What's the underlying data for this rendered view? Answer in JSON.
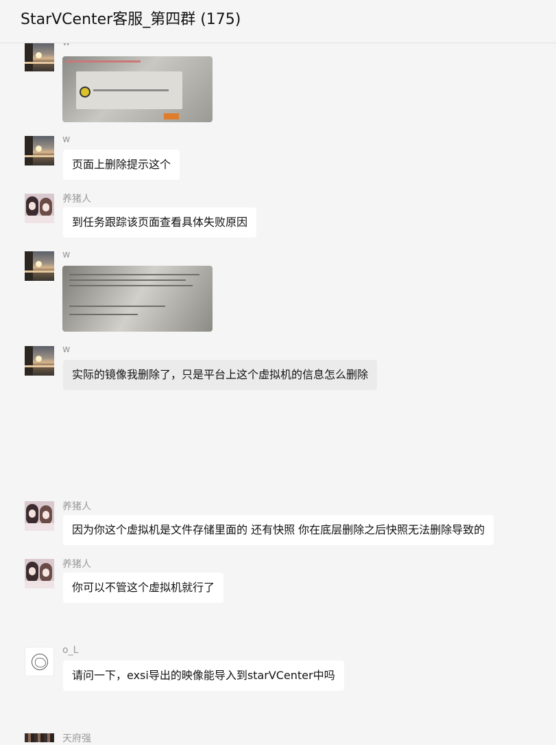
{
  "header": {
    "title": "StarVCenter客服_第四群 (175)"
  },
  "messages": {
    "m1": {
      "sender": "w"
    },
    "m2": {
      "sender": "w",
      "text": "页面上删除提示这个"
    },
    "m3": {
      "sender": "养猪人",
      "text": "到任务跟踪该页面查看具体失败原因"
    },
    "m4": {
      "sender": "w"
    },
    "m5": {
      "sender": "w",
      "text": "实际的镜像我删除了，只是平台上这个虚拟机的信息怎么删除"
    },
    "m6": {
      "sender": "养猪人",
      "text": "因为你这个虚拟机是文件存储里面的 还有快照 你在底层删除之后快照无法删除导致的"
    },
    "m7": {
      "sender": "养猪人",
      "text": "你可以不管这个虚拟机就行了"
    },
    "m8": {
      "sender": "o_L",
      "text": "请问一下，exsi导出的映像能导入到starVCenter中吗"
    },
    "m9": {
      "sender": "天府强"
    }
  }
}
